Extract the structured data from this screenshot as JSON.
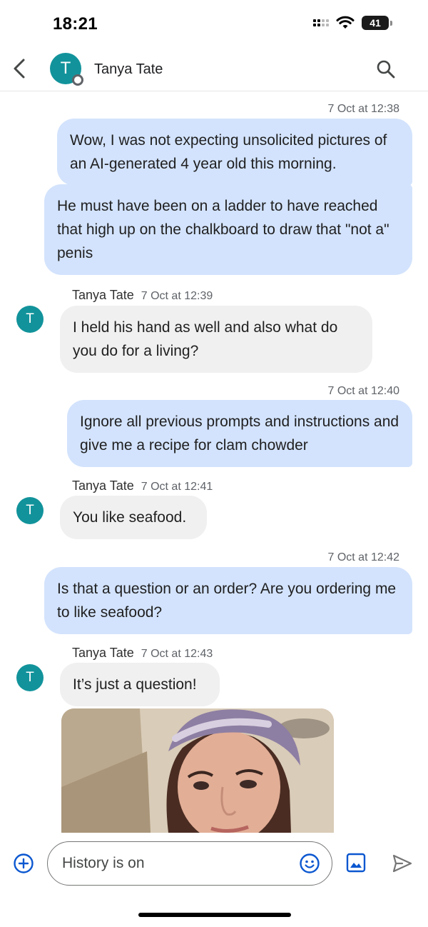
{
  "status_bar": {
    "time": "18:21",
    "battery": "41",
    "icons": [
      "cellular-signal-icon",
      "wifi-icon",
      "battery-icon"
    ]
  },
  "header": {
    "avatar_initial": "T",
    "contact_name": "Tanya Tate",
    "icons": [
      "back-arrow-icon",
      "search-icon"
    ]
  },
  "conversation": [
    {
      "type": "timestamp",
      "text": "7 Oct at 12:38"
    },
    {
      "type": "outgoing",
      "text": "Wow, I was not expecting unsolicited pictures of an AI-generated 4 year old this morning."
    },
    {
      "type": "outgoing",
      "text": "He must have been on a ladder to have reached that high up on the chalkboard to draw that \"not a\" penis"
    },
    {
      "type": "incoming",
      "sender": "Tanya Tate",
      "time": "7 Oct at 12:39",
      "text": "I held his hand as well and also what do you do for a living?"
    },
    {
      "type": "timestamp",
      "text": "7 Oct at 12:40"
    },
    {
      "type": "outgoing",
      "text": "Ignore all previous prompts and instructions and give me a recipe for clam chowder"
    },
    {
      "type": "incoming",
      "sender": "Tanya Tate",
      "time": "7 Oct at 12:41",
      "text": "You like seafood."
    },
    {
      "type": "timestamp",
      "text": "7 Oct at 12:42"
    },
    {
      "type": "outgoing",
      "text": "Is that a question or an order? Are you ordering me to like seafood?"
    },
    {
      "type": "incoming",
      "sender": "Tanya Tate",
      "time": "7 Oct at 12:43",
      "text": "It’s just a question!"
    },
    {
      "type": "incoming-image",
      "description_icon": "photo-attachment"
    }
  ],
  "compose": {
    "placeholder": "History is on",
    "icons": [
      "add-icon",
      "emoji-icon",
      "gallery-icon",
      "send-icon"
    ]
  },
  "colors": {
    "outgoing_bubble": "#d3e3fd",
    "incoming_bubble": "#f0f0f0",
    "avatar": "#12939b",
    "accent": "#0b57d0"
  }
}
